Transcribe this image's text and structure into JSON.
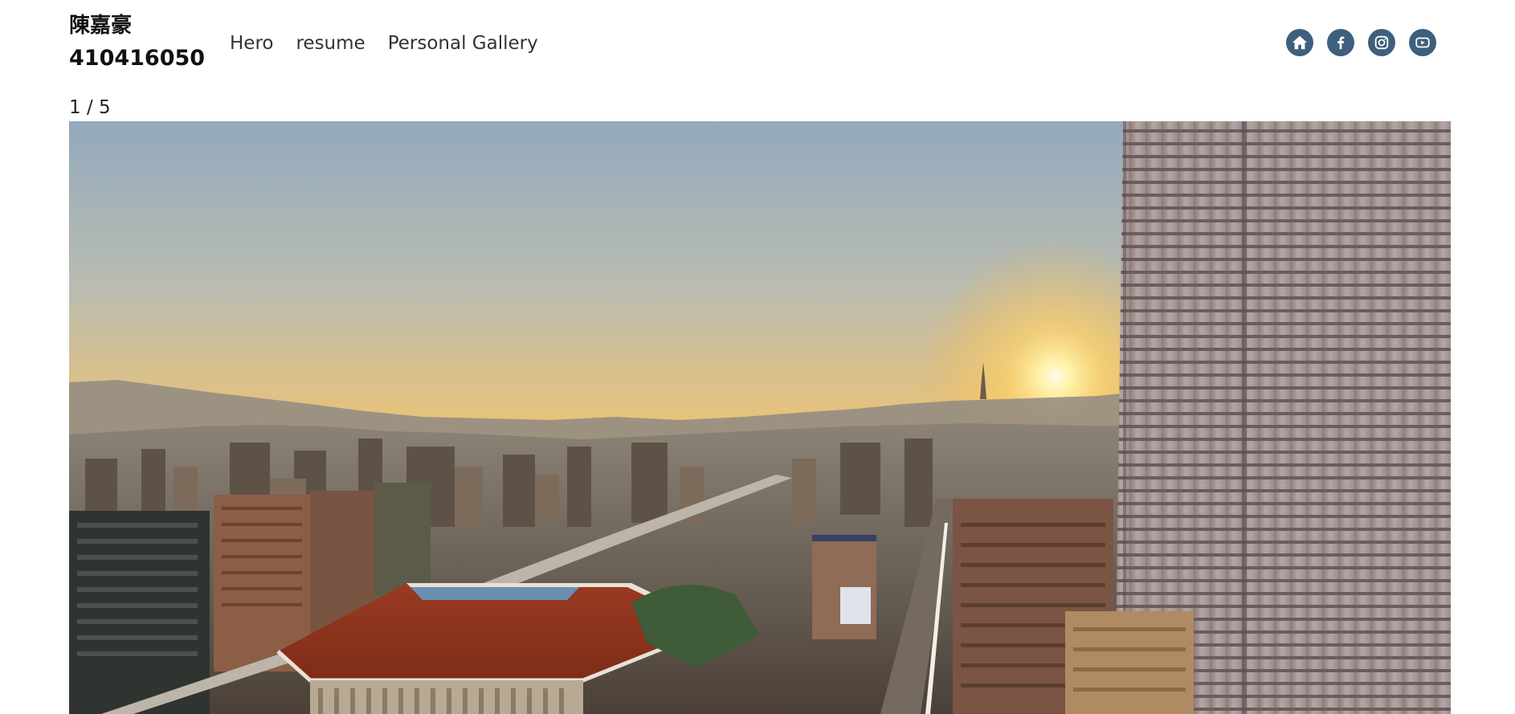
{
  "header": {
    "name": "陳嘉豪",
    "student_id": "410416050"
  },
  "nav": {
    "items": [
      {
        "label": "Hero"
      },
      {
        "label": "resume"
      },
      {
        "label": "Personal Gallery"
      }
    ]
  },
  "social": {
    "icons": [
      "home-icon",
      "facebook-icon",
      "instagram-icon",
      "youtube-icon"
    ],
    "color": "#3e5f7d"
  },
  "gallery": {
    "counter": "1 / 5",
    "current_slide": 1,
    "total_slides": 5
  }
}
